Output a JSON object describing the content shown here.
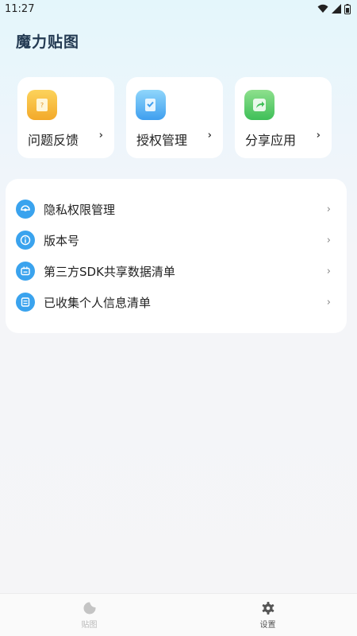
{
  "status_bar": {
    "time": "11:27"
  },
  "header": {
    "title": "魔力贴图"
  },
  "cards": [
    {
      "label": "问题反馈",
      "icon": "feedback-icon",
      "color": "#f7b733"
    },
    {
      "label": "授权管理",
      "icon": "authorization-icon",
      "color": "#4fb2f5"
    },
    {
      "label": "分享应用",
      "icon": "share-icon",
      "color": "#5ccb6a"
    }
  ],
  "menu": {
    "items": [
      {
        "label": "隐私权限管理",
        "icon": "privacy-icon"
      },
      {
        "label": "版本号",
        "icon": "info-icon"
      },
      {
        "label": "第三方SDK共享数据清单",
        "icon": "sdk-list-icon"
      },
      {
        "label": "已收集个人信息清单",
        "icon": "personal-info-icon"
      }
    ]
  },
  "bottom_nav": {
    "items": [
      {
        "label": "贴图",
        "icon": "sticker-icon",
        "active": false
      },
      {
        "label": "设置",
        "icon": "gear-icon",
        "active": true
      }
    ]
  },
  "colors": {
    "accent": "#3aa3ee",
    "title": "#233a52",
    "nav_inactive": "#bbbbbb",
    "nav_active": "#555555"
  }
}
